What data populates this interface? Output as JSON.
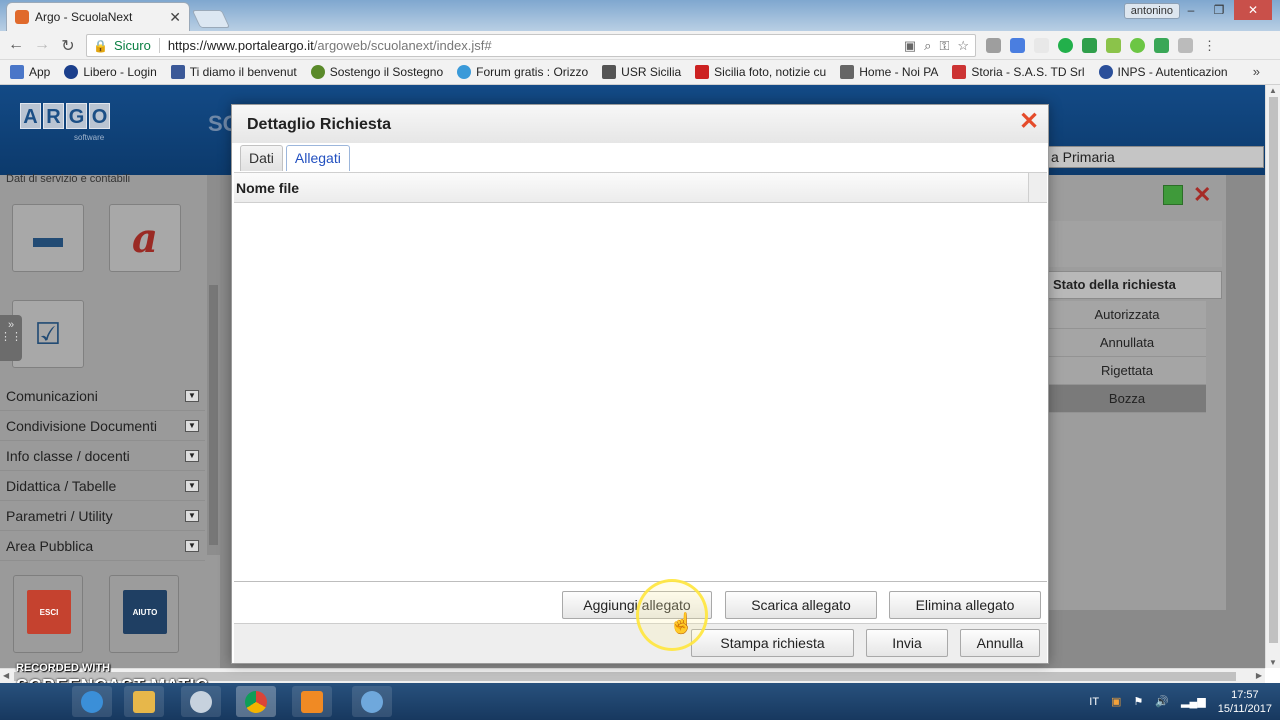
{
  "browser": {
    "tab_title": "Argo - ScuolaNext",
    "tab_close": "✕",
    "profile": "antonino",
    "secure_label": "Sicuro",
    "url_host": "https://www.portaleargo.it",
    "url_path": "/argoweb/scuolanext/index.jsf#",
    "bookmarks": [
      {
        "label": "App",
        "color": "#4a76c8"
      },
      {
        "label": "Libero - Login",
        "color": "#1b3f8c"
      },
      {
        "label": "Ti diamo il benvenut",
        "color": "#3b5998"
      },
      {
        "label": "Sostengo il Sostegno",
        "color": "#5a8a2a"
      },
      {
        "label": "Forum gratis : Orizzo",
        "color": "#3a9ad9"
      },
      {
        "label": "USR Sicilia",
        "color": "#555555"
      },
      {
        "label": "Sicilia foto, notizie cu",
        "color": "#cc2222"
      },
      {
        "label": "Home - Noi PA",
        "color": "#666666"
      },
      {
        "label": "Storia - S.A.S. TD Srl",
        "color": "#cc3333"
      },
      {
        "label": "INPS - Autenticazion",
        "color": "#2a4f9a"
      }
    ],
    "bookmarks_more": "»"
  },
  "app": {
    "logo_letters": [
      "A",
      "R",
      "G",
      "O"
    ],
    "logo_sub": "software",
    "left_caption": "Dati di servizio e contabili",
    "menu": [
      {
        "label": "Comunicazioni"
      },
      {
        "label": "Condivisione Documenti"
      },
      {
        "label": "Info classe / docenti"
      },
      {
        "label": "Didattica / Tabelle"
      },
      {
        "label": "Parametri / Utility"
      },
      {
        "label": "Area Pubblica"
      }
    ],
    "esci_label": "ESCI",
    "aiuto_label": "AIUTO",
    "breadcrumb": "a Primaria",
    "status_header": "Stato della richiesta",
    "status_rows": [
      "Autorizzata",
      "Annullata",
      "Rigettata",
      "Bozza"
    ]
  },
  "dialog": {
    "title": "Dettaglio Richiesta",
    "tabs": [
      "Dati",
      "Allegati"
    ],
    "active_tab": "Allegati",
    "column_header": "Nome file",
    "buttons": {
      "add": "Aggiungi allegato",
      "download": "Scarica allegato",
      "delete": "Elimina allegato",
      "print": "Stampa richiesta",
      "send": "Invia",
      "cancel": "Annulla"
    }
  },
  "watermark": {
    "line1": "RECORDED WITH",
    "line2": "SCREENCAST  MATIC"
  },
  "taskbar": {
    "lang": "IT",
    "time": "17:57",
    "date": "15/11/2017"
  },
  "colors": {
    "accent_tab": "#2250c0",
    "close_red": "#e54b2a",
    "app_header": "#134a86"
  }
}
